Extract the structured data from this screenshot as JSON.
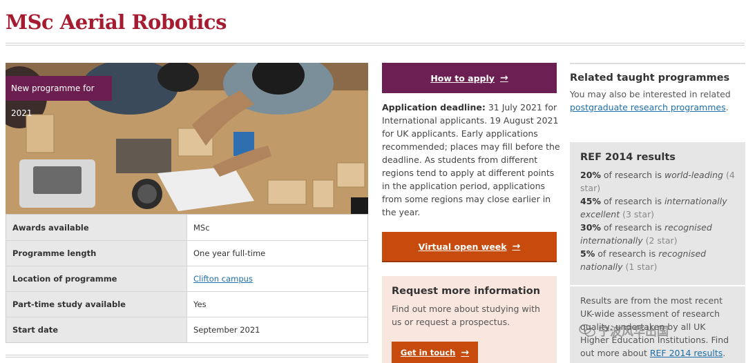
{
  "header": {
    "title": "MSc Aerial Robotics"
  },
  "hero": {
    "badge": "New programme for 2021",
    "image_alt": "students-building-robotics"
  },
  "facts": [
    {
      "label": "Awards available",
      "value": "MSc"
    },
    {
      "label": "Programme length",
      "value": "One year full-time"
    },
    {
      "label": "Location of programme",
      "value": "Clifton campus"
    },
    {
      "label": "Part-time study available",
      "value": "Yes"
    },
    {
      "label": "Start date",
      "value": "September 2021"
    }
  ],
  "apply": {
    "button_label": "How to apply",
    "deadline_label": "Application deadline:",
    "deadline_text": " 31 July 2021 for International applicants. 19 August 2021 for UK applicants. Early applications recommended; places may fill before the deadline. As students from different regions tend to apply at different points in the application period, applications from some regions may close earlier in the year."
  },
  "open_week": {
    "button_label": "Virtual open week"
  },
  "request": {
    "title": "Request more information",
    "text": "Find out more about studying with us or request a prospectus.",
    "button_label": "Get in touch"
  },
  "related": {
    "title": "Related taught programmes",
    "text_before": "You may also be interested in related ",
    "link": "postgraduate research programmes",
    "text_after": "."
  },
  "ref": {
    "title": "REF 2014 results",
    "items": [
      {
        "pct": "20%",
        "text": " of research is ",
        "quality": "world-leading",
        "stars": " (4 star)"
      },
      {
        "pct": "45%",
        "text": " of research is ",
        "quality": "internationally excellent",
        "stars": " (3 star)"
      },
      {
        "pct": "30%",
        "text": " of research is ",
        "quality": "recognised internationally",
        "stars": " (2 star)"
      },
      {
        "pct": "5%",
        "text": " of research is ",
        "quality": "recognised nationally",
        "stars": " (1 star)"
      }
    ],
    "note_before": "Results are from the most recent UK-wide assessment of research quality, undertaken by all UK Higher Education Institutions. Find out more about ",
    "note_link": "REF 2014 results",
    "note_after": "."
  },
  "watermark": {
    "text": "宁波风华出国",
    "icon": "wechat-icon"
  },
  "colors": {
    "brand": "#a51c30",
    "apply": "#6c1f52",
    "orange": "#c64b0c",
    "link": "#1d6ea8",
    "request_bg": "#f9e7df",
    "ref_bg": "#e6e6e6"
  }
}
